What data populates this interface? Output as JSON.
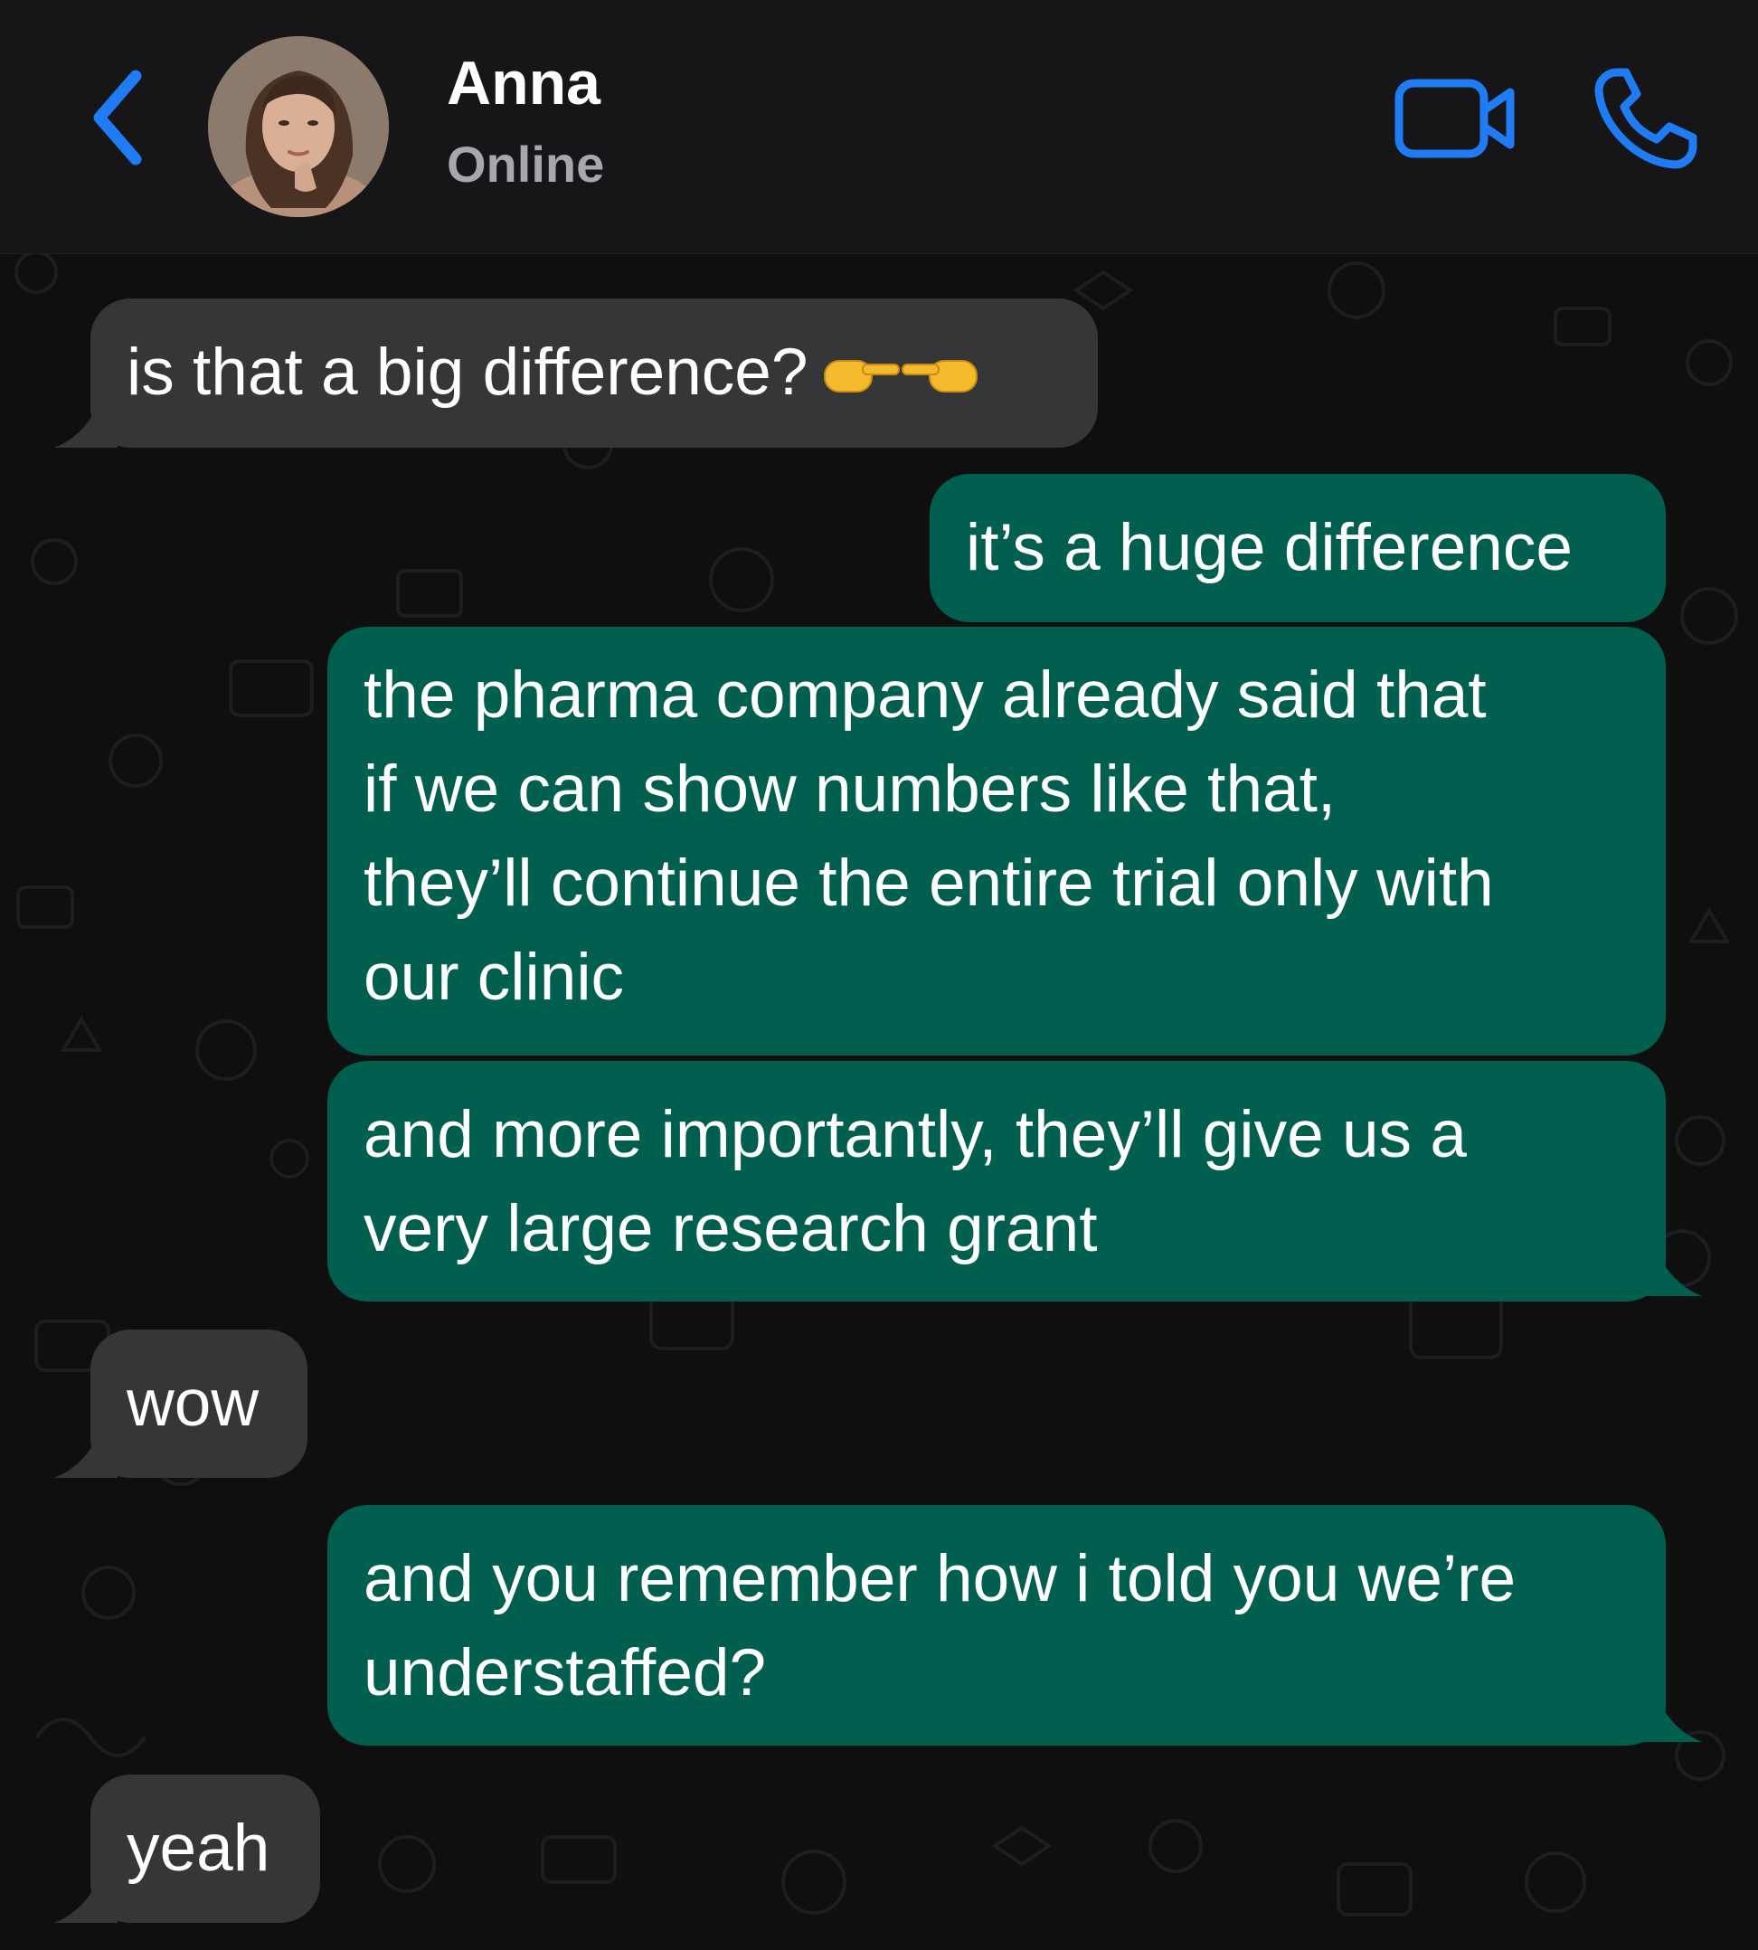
{
  "header": {
    "contact_name": "Anna",
    "status": "Online",
    "back_icon": "chevron-left-icon",
    "video_icon": "video-camera-icon",
    "call_icon": "phone-icon"
  },
  "colors": {
    "accent": "#1f7cf5",
    "incoming_bubble": "#363638",
    "outgoing_bubble": "#005f4e",
    "header_bg": "#161618",
    "chat_bg": "#0f0f10"
  },
  "messages": [
    {
      "direction": "incoming",
      "text": "is that a big difference?",
      "emoji": "👉👈"
    },
    {
      "direction": "outgoing",
      "text": "it’s a huge difference"
    },
    {
      "direction": "outgoing",
      "lines": [
        "the pharma company already said that",
        "if we can show numbers like that,",
        "they’ll continue the entire trial only with",
        "our clinic"
      ]
    },
    {
      "direction": "outgoing",
      "lines": [
        "and more importantly, they’ll give us a",
        "very large research grant"
      ]
    },
    {
      "direction": "incoming",
      "text": "wow"
    },
    {
      "direction": "outgoing",
      "lines": [
        "and you remember how i told you we’re",
        "understaffed?"
      ]
    },
    {
      "direction": "incoming",
      "text": "yeah"
    }
  ]
}
